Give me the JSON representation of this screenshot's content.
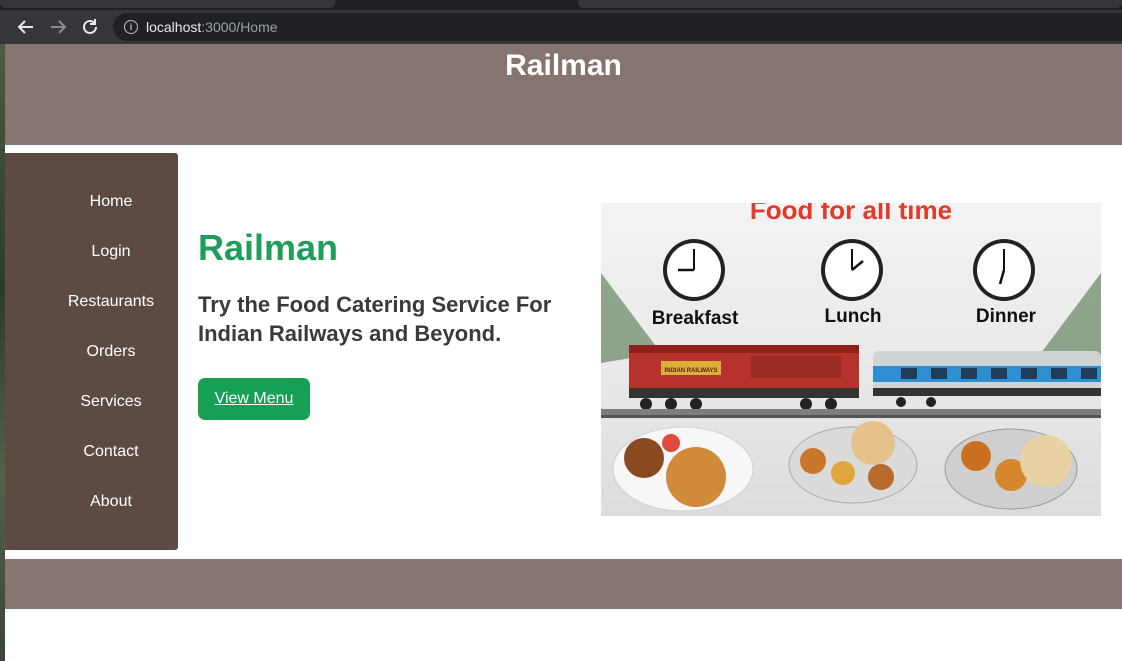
{
  "browser": {
    "url_host": "localhost",
    "url_path": ":3000/Home"
  },
  "header": {
    "title": "Railman"
  },
  "sidebar": {
    "items": [
      {
        "label": "Home"
      },
      {
        "label": "Login"
      },
      {
        "label": "Restaurants"
      },
      {
        "label": "Orders"
      },
      {
        "label": "Services"
      },
      {
        "label": "Contact"
      },
      {
        "label": "About"
      }
    ]
  },
  "hero": {
    "title": "Railman",
    "subtitle": "Try the Food Catering Service For Indian Railways and Beyond.",
    "cta_label": "View Menu"
  },
  "banner": {
    "headline": "Food for all time",
    "meals": [
      "Breakfast",
      "Lunch",
      "Dinner"
    ],
    "engine_text": "INDIAN RAILWAYS"
  },
  "colors": {
    "header_bg": "#857470",
    "sidebar_bg": "#5d4b43",
    "accent_green": "#1f9e5b",
    "button_green": "#169f55"
  },
  "icons": {
    "back": "arrow-left-icon",
    "forward": "arrow-right-icon",
    "reload": "reload-icon",
    "site_info": "info-icon"
  }
}
